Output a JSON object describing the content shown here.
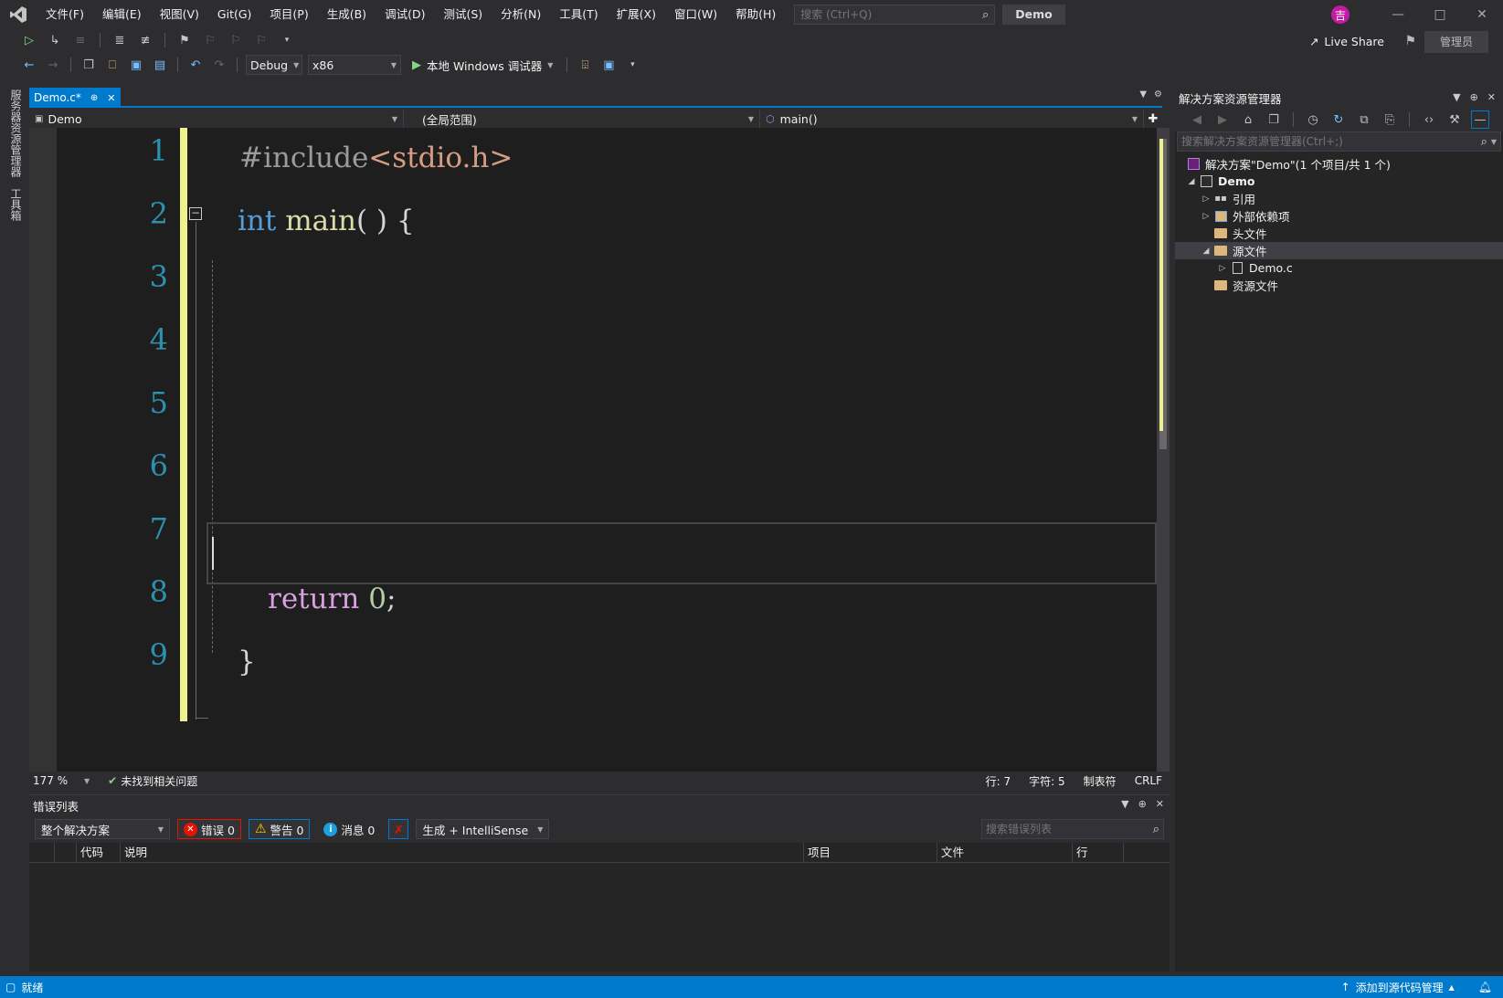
{
  "menu": {
    "items": [
      "文件(F)",
      "编辑(E)",
      "视图(V)",
      "Git(G)",
      "项目(P)",
      "生成(B)",
      "调试(D)",
      "测试(S)",
      "分析(N)",
      "工具(T)",
      "扩展(X)",
      "窗口(W)",
      "帮助(H)"
    ],
    "search_placeholder": "搜索 (Ctrl+Q)",
    "solution_name": "Demo",
    "user_initial": "吉"
  },
  "toolbar": {
    "config": "Debug",
    "platform": "x86",
    "run_label": "本地 Windows 调试器",
    "live_share": "Live Share",
    "admin": "管理员"
  },
  "left_rail": {
    "server_explorer": "服务器资源管理器",
    "toolbox": "工具箱"
  },
  "editor": {
    "tab_label": "Demo.c*",
    "nav_project": "Demo",
    "nav_scope": "(全局范围)",
    "nav_member": "main()",
    "line_numbers": [
      "1",
      "2",
      "3",
      "4",
      "5",
      "6",
      "7",
      "8",
      "9"
    ],
    "code": {
      "l1_pre": "#include",
      "l1_inc": "<stdio.h>",
      "l2_kw": "int",
      "l2_fn": "main",
      "l2_rest": "( ) {",
      "l8_kw": "return",
      "l8_num": "0",
      "l8_semi": ";",
      "l9": "}"
    },
    "fold_symbol": "−"
  },
  "editor_status": {
    "zoom": "177 %",
    "issues": "未找到相关问题",
    "line": "行: 7",
    "char": "字符: 5",
    "tabs": "制表符",
    "eol": "CRLF"
  },
  "error_list": {
    "title": "错误列表",
    "scope": "整个解决方案",
    "errors": "错误 0",
    "warnings": "警告 0",
    "messages": "消息 0",
    "build_filter": "生成 + IntelliSense",
    "search_placeholder": "搜索错误列表",
    "columns": {
      "code": "代码",
      "desc": "说明",
      "project": "项目",
      "file": "文件",
      "line": "行"
    }
  },
  "solution_explorer": {
    "title": "解决方案资源管理器",
    "search_placeholder": "搜索解决方案资源管理器(Ctrl+;)",
    "solution": "解决方案\"Demo\"(1 个项目/共 1 个)",
    "project": "Demo",
    "references": "引用",
    "external_deps": "外部依赖项",
    "headers": "头文件",
    "sources": "源文件",
    "source_file": "Demo.c",
    "resources": "资源文件"
  },
  "statusbar": {
    "ready": "就绪",
    "source_control": "添加到源代码管理"
  },
  "colors": {
    "accent": "#007acc",
    "change_bar": "#eff18c",
    "line_number": "#2b91af",
    "keyword": "#569cd6",
    "function": "#dcdcaa",
    "include": "#d69d85",
    "control": "#d8a0df"
  }
}
